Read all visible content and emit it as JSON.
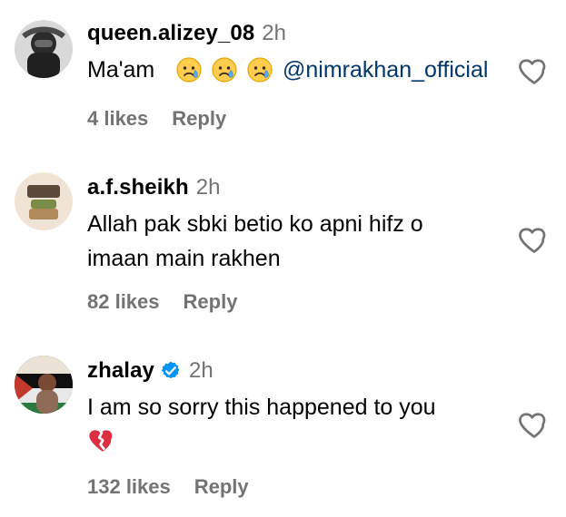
{
  "comments": [
    {
      "username": "queen.alizey_08",
      "time": "2h",
      "text_prefix": "Ma'am",
      "emojis": [
        "crying-face-emoji",
        "crying-face-emoji",
        "crying-face-emoji"
      ],
      "mention": "@nimrakhan_official",
      "likes": "4 likes",
      "reply": "Reply",
      "verified": false
    },
    {
      "username": "a.f.sheikh",
      "time": "2h",
      "text_line1": "Allah pak sbki betio ko apni hifz o",
      "text_line2": "imaan main rakhen",
      "likes": "82 likes",
      "reply": "Reply",
      "verified": false
    },
    {
      "username": "zhalay",
      "time": "2h",
      "text_line1": "I am so sorry this happened to you",
      "emoji_line2": "broken-heart-emoji",
      "likes": "132 likes",
      "reply": "Reply",
      "verified": true
    }
  ],
  "colors": {
    "meta": "#737373",
    "mention": "#00376b",
    "verified": "#0095f6"
  },
  "icons": {
    "like": "heart-outline-icon",
    "verified": "verified-badge-icon"
  }
}
